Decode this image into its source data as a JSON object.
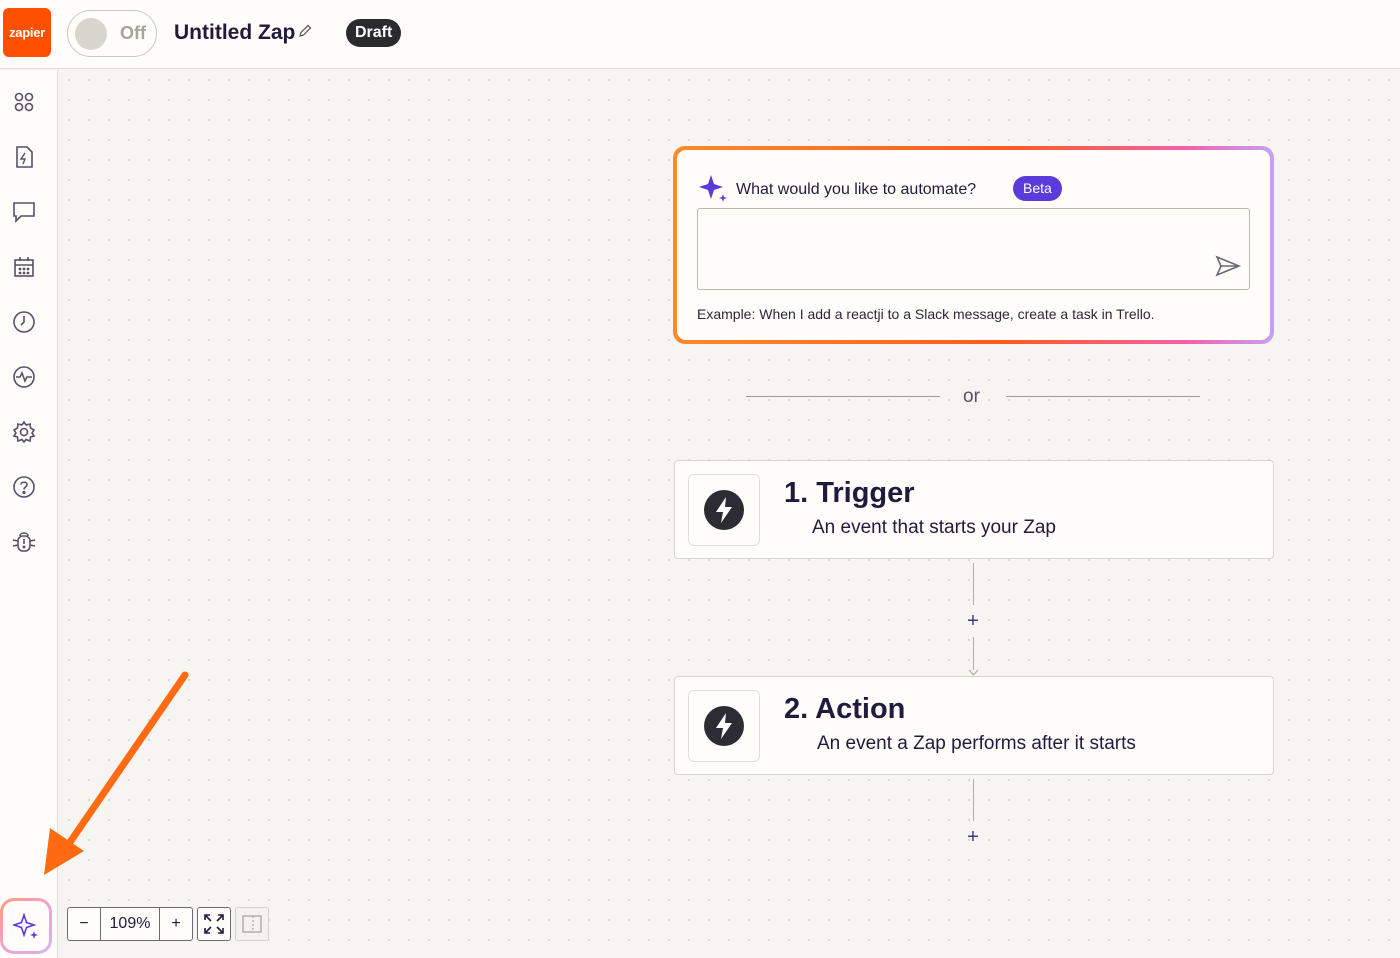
{
  "brand": {
    "logo_text": "zapier",
    "color": "#ff4f00"
  },
  "header": {
    "toggle_label": "Off",
    "zap_title": "Untitled Zap",
    "status_badge": "Draft"
  },
  "sidebar": {
    "items": [
      {
        "icon": "apps-icon"
      },
      {
        "icon": "zap-file-icon"
      },
      {
        "icon": "comment-icon"
      },
      {
        "icon": "calendar-icon"
      },
      {
        "icon": "clock-icon"
      },
      {
        "icon": "activity-icon"
      },
      {
        "icon": "settings-icon"
      },
      {
        "icon": "help-icon"
      },
      {
        "icon": "bug-icon"
      }
    ]
  },
  "ai_prompt": {
    "question": "What would you like to automate?",
    "badge": "Beta",
    "example": "Example: When I add a reactji to a Slack message, create a task in Trello."
  },
  "divider": {
    "text": "or"
  },
  "steps": [
    {
      "title": "1. Trigger",
      "description": "An event that starts your Zap"
    },
    {
      "title": "2. Action",
      "description": "An event a Zap performs after it starts"
    }
  ],
  "connectors": {
    "add_symbol": "+"
  },
  "zoom": {
    "minus": "−",
    "level": "109%",
    "plus": "+"
  },
  "colors": {
    "accent": "#5b3bd9",
    "orange": "#ff5a1f",
    "canvas": "#f7f5f1"
  }
}
